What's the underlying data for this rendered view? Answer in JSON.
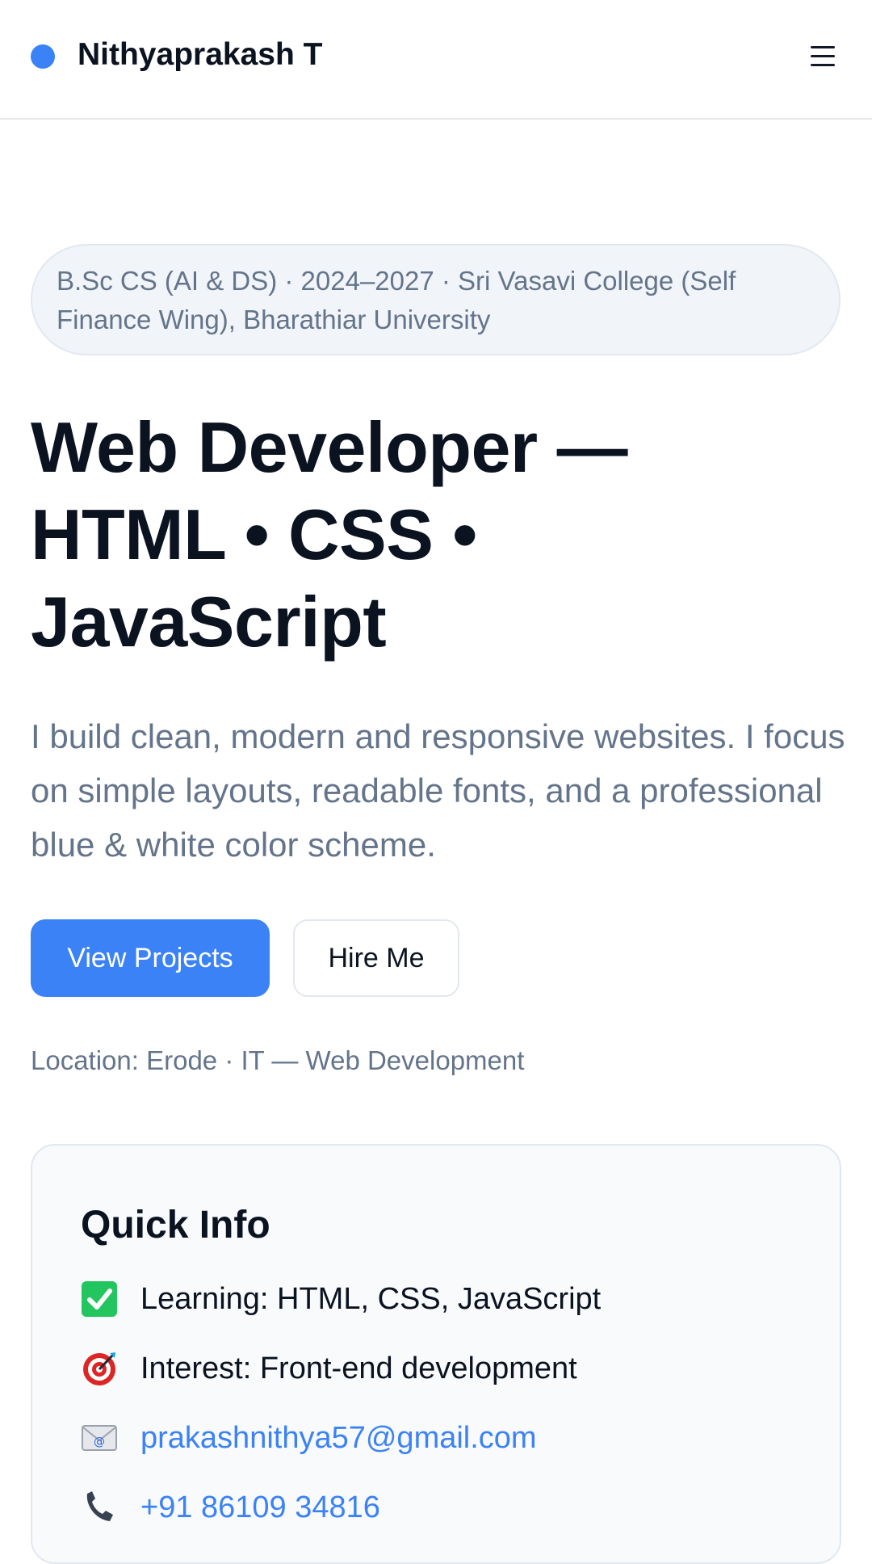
{
  "header": {
    "brand_name": "Nithyaprakash T",
    "menu_icon": "hamburger-menu-icon"
  },
  "hero": {
    "education": "B.Sc CS (AI & DS) · 2024–2027 · Sri Vasavi College (Self Finance Wing), Bharathiar University",
    "title_line1": "Web Developer —",
    "title_line2": "HTML • CSS •",
    "title_line3": "JavaScript",
    "description": "I build clean, modern and responsive websites. I focus on simple layouts, readable fonts, and a professional blue & white color scheme.",
    "primary_button": "View Projects",
    "secondary_button": "Hire Me",
    "location": "Location: Erode · IT — Web Development"
  },
  "quick_info": {
    "title": "Quick Info",
    "items": [
      {
        "icon": "check-mark-icon",
        "text": "Learning: HTML, CSS, JavaScript"
      },
      {
        "icon": "target-icon",
        "text": "Interest: Front-end development"
      },
      {
        "icon": "envelope-icon",
        "text": "prakashnithya57@gmail.com"
      },
      {
        "icon": "phone-icon",
        "text": "+91 86109 34816"
      }
    ]
  },
  "colors": {
    "accent": "#3b82f6",
    "text_dark": "#0b1220",
    "text_muted": "#64748b",
    "border": "#e2e8f0"
  }
}
